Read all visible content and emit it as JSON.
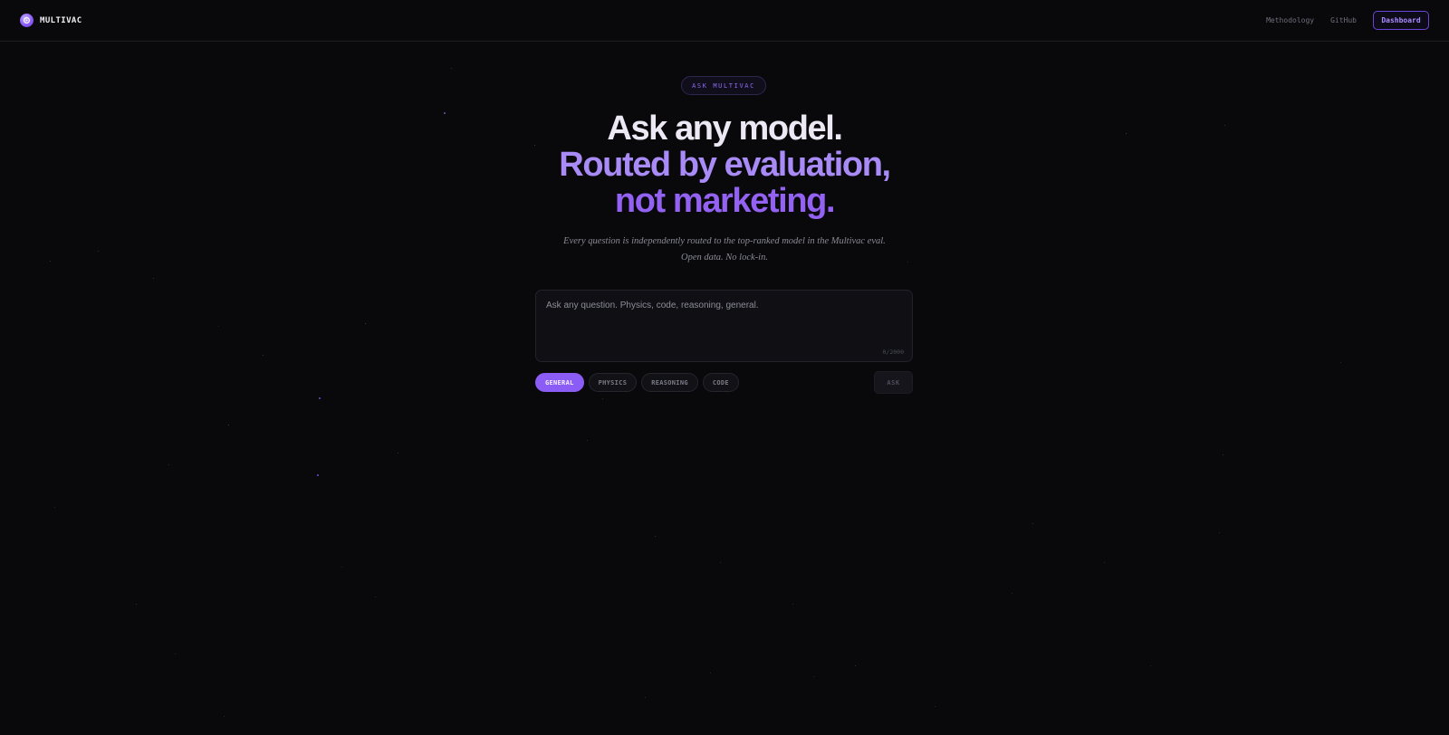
{
  "header": {
    "brand": "MULTIVAC",
    "nav": {
      "methodology": "Methodology",
      "github": "GitHub",
      "dashboard": "Dashboard"
    }
  },
  "hero": {
    "pill": "ASK MULTIVAC",
    "headline_line1": "Ask any model.",
    "headline_line2": "Routed by evaluation,",
    "headline_line3": "not marketing.",
    "sub_line1": "Every question is independently routed to the top-ranked model in the Multivac eval.",
    "sub_line2": "Open data. No lock-in."
  },
  "ask": {
    "placeholder": "Ask any question. Physics, code, reasoning, general.",
    "value": "",
    "counter": "0/2000",
    "categories": [
      {
        "label": "GENERAL",
        "active": true
      },
      {
        "label": "PHYSICS",
        "active": false
      },
      {
        "label": "REASONING",
        "active": false
      },
      {
        "label": "CODE",
        "active": false
      }
    ],
    "button": "ASK"
  },
  "colors": {
    "background": "#09090c",
    "accent": "#8b5cf6",
    "accent_light": "#a98bf7"
  }
}
